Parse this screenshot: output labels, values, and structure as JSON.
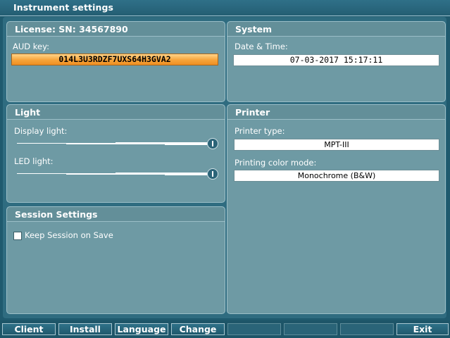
{
  "window": {
    "title": "Instrument settings"
  },
  "license": {
    "heading": "License: SN: 34567890",
    "aud_key_label": "AUD key:",
    "aud_key_value": "014L3U3RDZF7UXS64H3GVA2"
  },
  "system": {
    "heading": "System",
    "datetime_label": "Date & Time:",
    "datetime_value": "07-03-2017 15:17:11"
  },
  "light": {
    "heading": "Light",
    "display_label": "Display light:",
    "display_level": 1.0,
    "led_label": "LED light:",
    "led_level": 1.0
  },
  "printer": {
    "heading": "Printer",
    "type_label": "Printer type:",
    "type_value": "MPT-III",
    "color_mode_label": "Printing color mode:",
    "color_mode_value": "Monochrome (B&W)"
  },
  "session": {
    "heading": "Session Settings",
    "keep_label": "Keep Session on Save",
    "keep_checked": false
  },
  "toolbar": {
    "client": "Client",
    "install": "Install",
    "language": "Language",
    "change": "Change",
    "exit": "Exit"
  }
}
